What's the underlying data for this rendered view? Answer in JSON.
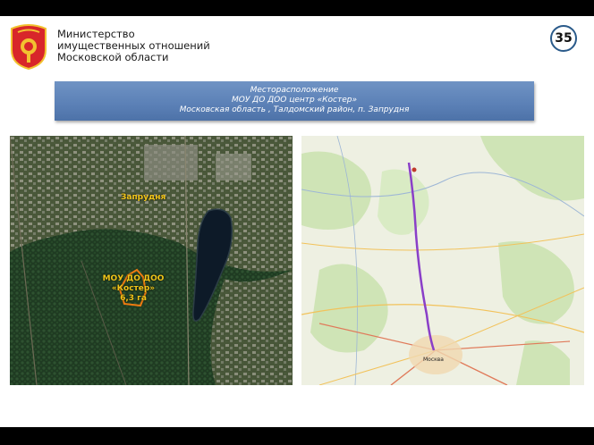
{
  "header": {
    "ministry_lines": [
      "Министерство",
      "имущественных отношений",
      "Московской области"
    ],
    "page_number": "35"
  },
  "banner": {
    "line1": "Месторасположение",
    "line2": "МОУ ДО ДОО центр «Костер»",
    "line3": "Московская область , Талдомский район, п. Запрудня"
  },
  "satellite": {
    "village_label": "Запрудня",
    "object_line1": "МОУ ДО ДОО",
    "object_line2": "«Костер»",
    "object_line3": "6,3 га"
  },
  "map": {
    "city_label": "Москва"
  },
  "colors": {
    "banner": "#5b80b6",
    "label": "#f0c419",
    "route": "#8a3fc8"
  }
}
